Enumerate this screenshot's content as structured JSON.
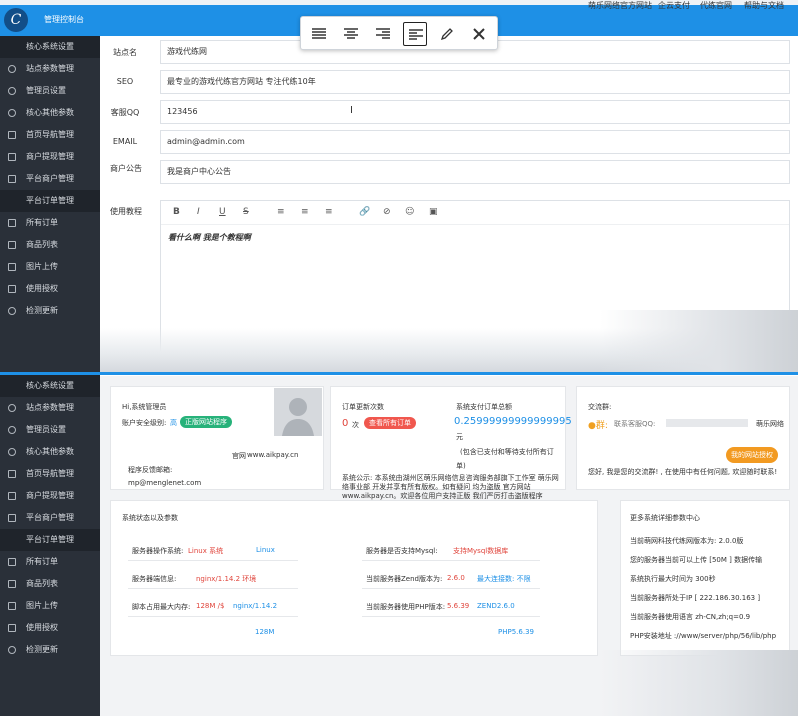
{
  "header": {
    "app_title": "管理控制台",
    "logo_letter": "C",
    "nav": [
      "萌乐网络官方网站",
      "企云支付",
      "代练官网",
      "帮助与文档"
    ]
  },
  "sidebar_top": [
    {
      "label": "核心系统设置",
      "group": true
    },
    {
      "label": "站点参数管理",
      "icon": "circle"
    },
    {
      "label": "管理员设置",
      "icon": "circle"
    },
    {
      "label": "核心其他参数",
      "icon": "circle"
    },
    {
      "label": "首页导航管理",
      "icon": "square"
    },
    {
      "label": "商户提现管理",
      "icon": "square"
    },
    {
      "label": "平台商户管理",
      "icon": "square"
    },
    {
      "label": "平台订单管理",
      "group": true
    },
    {
      "label": "所有订单",
      "icon": "square"
    },
    {
      "label": "商品列表",
      "icon": "square"
    },
    {
      "label": "图片上传",
      "icon": "square"
    },
    {
      "label": "使用授权",
      "icon": "square"
    },
    {
      "label": "检测更新",
      "icon": "circle"
    }
  ],
  "sidebar_bottom": [
    {
      "label": "核心系统设置",
      "group": true
    },
    {
      "label": "站点参数管理",
      "icon": "circle"
    },
    {
      "label": "管理员设置",
      "icon": "circle"
    },
    {
      "label": "核心其他参数",
      "icon": "circle"
    },
    {
      "label": "首页导航管理",
      "icon": "square"
    },
    {
      "label": "商户提现管理",
      "icon": "square"
    },
    {
      "label": "平台商户管理",
      "icon": "square"
    },
    {
      "label": "平台订单管理",
      "group": true
    },
    {
      "label": "所有订单",
      "icon": "square"
    },
    {
      "label": "商品列表",
      "icon": "square"
    },
    {
      "label": "图片上传",
      "icon": "square"
    },
    {
      "label": "使用授权",
      "icon": "square"
    },
    {
      "label": "检测更新",
      "icon": "circle"
    }
  ],
  "toolbar": {
    "buttons": [
      "align-justify-icon",
      "align-center-icon",
      "align-right-icon",
      "align-left-icon",
      "pencil-icon",
      "close-icon"
    ],
    "active_index": 3
  },
  "form": {
    "site_name_label": "站点名",
    "site_name_value": "游戏代练网",
    "seo_label": "SEO",
    "seo_value": "最专业的游戏代练官方网站 专注代练10年",
    "qq_label": "客服QQ",
    "qq_value": "123456",
    "email_label": "EMAIL",
    "email_value": "admin@admin.com",
    "notice_label": "商户公告",
    "notice_value": "我是商户中心公告",
    "tutorial_label": "使用教程",
    "tutorial_content": "看什么啊 我是个教程啊"
  },
  "editor_buttons": [
    "B",
    "I",
    "U",
    "S",
    "≡",
    "≡",
    "≡",
    "🔗",
    "⊘",
    "☺",
    "▣"
  ],
  "dashboard": {
    "admin_greeting": "Hi,系统管理员",
    "security_label": "账户安全级别:",
    "security_level": "高",
    "genuine_badge": "正版网站程序",
    "official_site_label": "官网",
    "official_site_value": "www.aikpay.cn",
    "feedback_label": "程序反馈邮箱:",
    "feedback_email": "mp@menglenet.com",
    "orders_title": "订单更新次数",
    "orders_count": "0",
    "orders_unit": "次",
    "orders_button": "查看所有订单",
    "payment_title": "系统支付订单总额",
    "payment_value": "0.25999999999999995",
    "payment_unit": "元",
    "payment_note_1": "(包含已支付和等待支付所有订",
    "payment_note_2": "单)",
    "announcement": [
      "系统公示: 本系统由湖州区萌乐网络信息咨询服务部旗下工作室 萌乐网",
      "络事业部 开发并享有所有版权。如有疑问 均为盗版 官方网站",
      "www.aikpay.cn。欢迎各位用户支持正版 我们严厉打击盗版程序"
    ],
    "group_title": "交流群:",
    "group_prefix": "●群:",
    "group_label": "联系客服QQ:",
    "group_org": "萌乐网络",
    "license_button": "我的网站授权",
    "group_note": "您好, 我是您的交流群! , 在使用中有任何问题, 欢迎随时联系!",
    "status_title": "系统状态以及参数",
    "status_rows": [
      {
        "label": "服务器操作系统:",
        "value": "Linux 系统",
        "extra": "Linux",
        "label2": "服务器是否支持Mysql:",
        "value2": "支持Mysql数据库",
        "extra2": ""
      },
      {
        "label": "服务器端信息:",
        "value": "nginx/1.14.2 环境",
        "extra": "",
        "label2": "当前服务器Zend版本为:",
        "value2": "2.6.0",
        "extra2": "最大连接数: 不限"
      },
      {
        "label": "脚本占用最大内存:",
        "value": "128M /$",
        "extra": "nginx/1.14.2",
        "label2": "当前服务器使用PHP版本:",
        "value2": "5.6.39",
        "extra2": "ZEND2.6.0"
      }
    ],
    "status_footer_left": "128M",
    "status_footer_right": "PHP5.6.39",
    "details_title": "更多系统详细参数中心",
    "details": [
      "当前萌网科技代练网版本为: 2.0.0版",
      "您的服务器当前可以上传 [50M ] 数据传输",
      "系统执行最大时间为 300秒",
      "当前服务器所处于IP [ 222.186.30.163 ]",
      "当前服务器使用语言 zh-CN,zh;q=0.9",
      "PHP安装地址 ://www/server/php/56/lib/php"
    ]
  }
}
